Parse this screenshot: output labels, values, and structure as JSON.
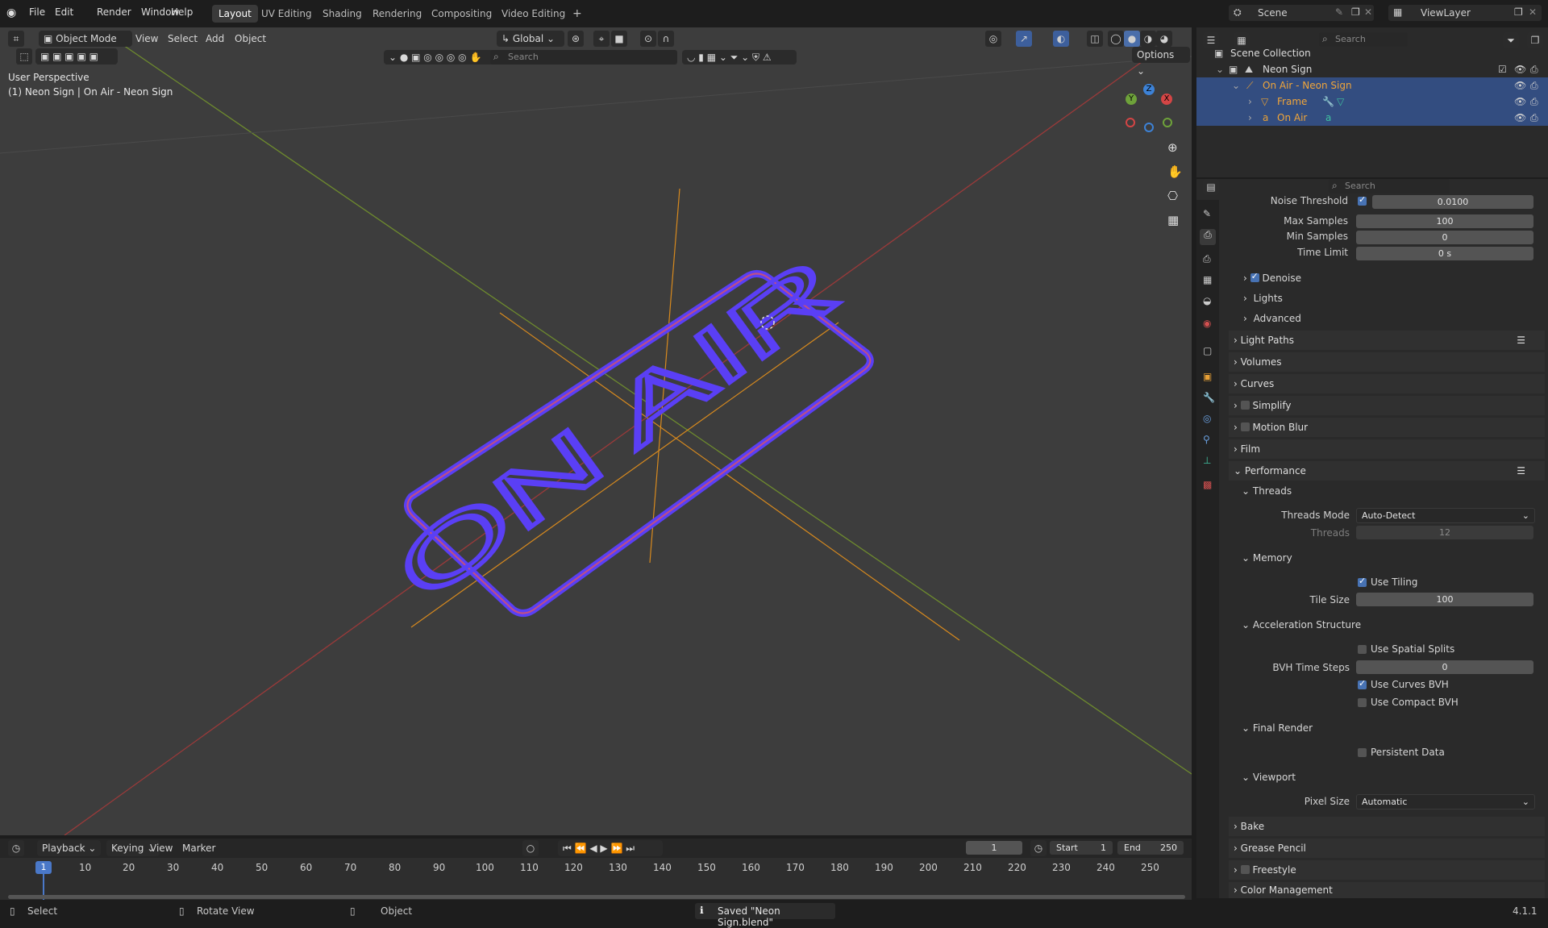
{
  "topbar": {
    "menus": [
      "File",
      "Edit",
      "Render",
      "Window",
      "Help"
    ],
    "workspaces": [
      "Layout",
      "UV Editing",
      "Shading",
      "Rendering",
      "Compositing",
      "Video Editing"
    ],
    "active_workspace": "Layout",
    "add_workspace": "+",
    "scene": "Scene",
    "view_layer": "ViewLayer"
  },
  "viewport": {
    "mode": "Object Mode",
    "menus": [
      "View",
      "Select",
      "Add",
      "Object"
    ],
    "transform_orientation": "Global",
    "options": "Options",
    "search_placeholder": "Search",
    "overlay_line1": "User Perspective",
    "overlay_line2": "(1) Neon Sign | On Air - Neon Sign",
    "sign_text": "ON AIR",
    "gizmo": {
      "x": "X",
      "y": "Y",
      "z": "Z"
    }
  },
  "outliner": {
    "search_placeholder": "Search",
    "items": [
      {
        "label": "Scene Collection"
      },
      {
        "label": "Neon Sign"
      },
      {
        "label": "On Air - Neon Sign"
      },
      {
        "label": "Frame"
      },
      {
        "label": "On Air"
      }
    ]
  },
  "properties": {
    "search_placeholder": "Search",
    "noise_threshold": {
      "label": "Noise Threshold",
      "value": "0.0100"
    },
    "max_samples": {
      "label": "Max Samples",
      "value": "100"
    },
    "min_samples": {
      "label": "Min Samples",
      "value": "0"
    },
    "time_limit": {
      "label": "Time Limit",
      "value": "0 s"
    },
    "denoise": "Denoise",
    "lights": "Lights",
    "advanced": "Advanced",
    "panels": [
      "Light Paths",
      "Volumes",
      "Curves",
      "Simplify",
      "Motion Blur",
      "Film",
      "Performance"
    ],
    "threads_panel": "Threads",
    "threads_mode": {
      "label": "Threads Mode",
      "value": "Auto-Detect"
    },
    "threads": {
      "label": "Threads",
      "value": "12"
    },
    "memory_panel": "Memory",
    "use_tiling": "Use Tiling",
    "tile_size": {
      "label": "Tile Size",
      "value": "100"
    },
    "accel_panel": "Acceleration Structure",
    "use_spatial_splits": "Use Spatial Splits",
    "bvh_time_steps": {
      "label": "BVH Time Steps",
      "value": "0"
    },
    "use_curves_bvh": "Use Curves BVH",
    "use_compact_bvh": "Use Compact BVH",
    "final_render_panel": "Final Render",
    "persistent_data": "Persistent Data",
    "viewport_panel": "Viewport",
    "pixel_size": {
      "label": "Pixel Size",
      "value": "Automatic"
    },
    "bottom_panels": [
      "Bake",
      "Grease Pencil",
      "Freestyle",
      "Color Management"
    ]
  },
  "timeline": {
    "menus": [
      "Playback",
      "Keying",
      "View",
      "Marker"
    ],
    "current_frame": "1",
    "start_label": "Start",
    "start": "1",
    "end_label": "End",
    "end": "250",
    "ticks": [
      "1",
      "10",
      "20",
      "30",
      "40",
      "50",
      "60",
      "70",
      "80",
      "90",
      "100",
      "110",
      "120",
      "130",
      "140",
      "150",
      "160",
      "170",
      "180",
      "190",
      "200",
      "210",
      "220",
      "230",
      "240",
      "250"
    ]
  },
  "status": {
    "select": "Select",
    "rotate": "Rotate View",
    "object": "Object",
    "message": "Saved \"Neon Sign.blend\"",
    "version": "4.1.1"
  }
}
